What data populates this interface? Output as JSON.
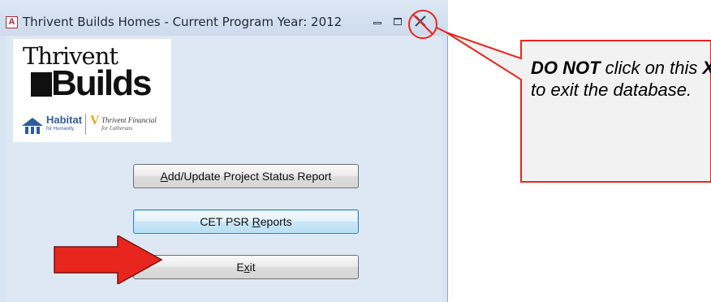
{
  "window": {
    "title": "Thrivent Builds Homes - Current Program Year: 2012",
    "app_icon_letter": "A"
  },
  "logo": {
    "line1": "Thrivent",
    "line2": "Builds",
    "habitat": "Habitat",
    "habitat_sub": "for Humanity",
    "thrivent_financial": "Thrivent Financial",
    "thrivent_financial_sub": "for Lutherans"
  },
  "buttons": {
    "add_update": {
      "before": "",
      "mnemonic": "A",
      "after": "dd/Update Project Status Report"
    },
    "cet_psr": {
      "before": "CET PSR ",
      "mnemonic": "R",
      "after": "eports"
    },
    "exit": {
      "before": "E",
      "mnemonic": "x",
      "after": "it"
    }
  },
  "callout": {
    "bold_1": "DO NOT",
    "text_1": " click on this ",
    "bold_2": "X",
    "text_2": " to exit the database."
  },
  "colors": {
    "annotation_red": "#e8261e",
    "window_bg": "#dde8f4",
    "callout_bg": "#f2f2f2"
  }
}
